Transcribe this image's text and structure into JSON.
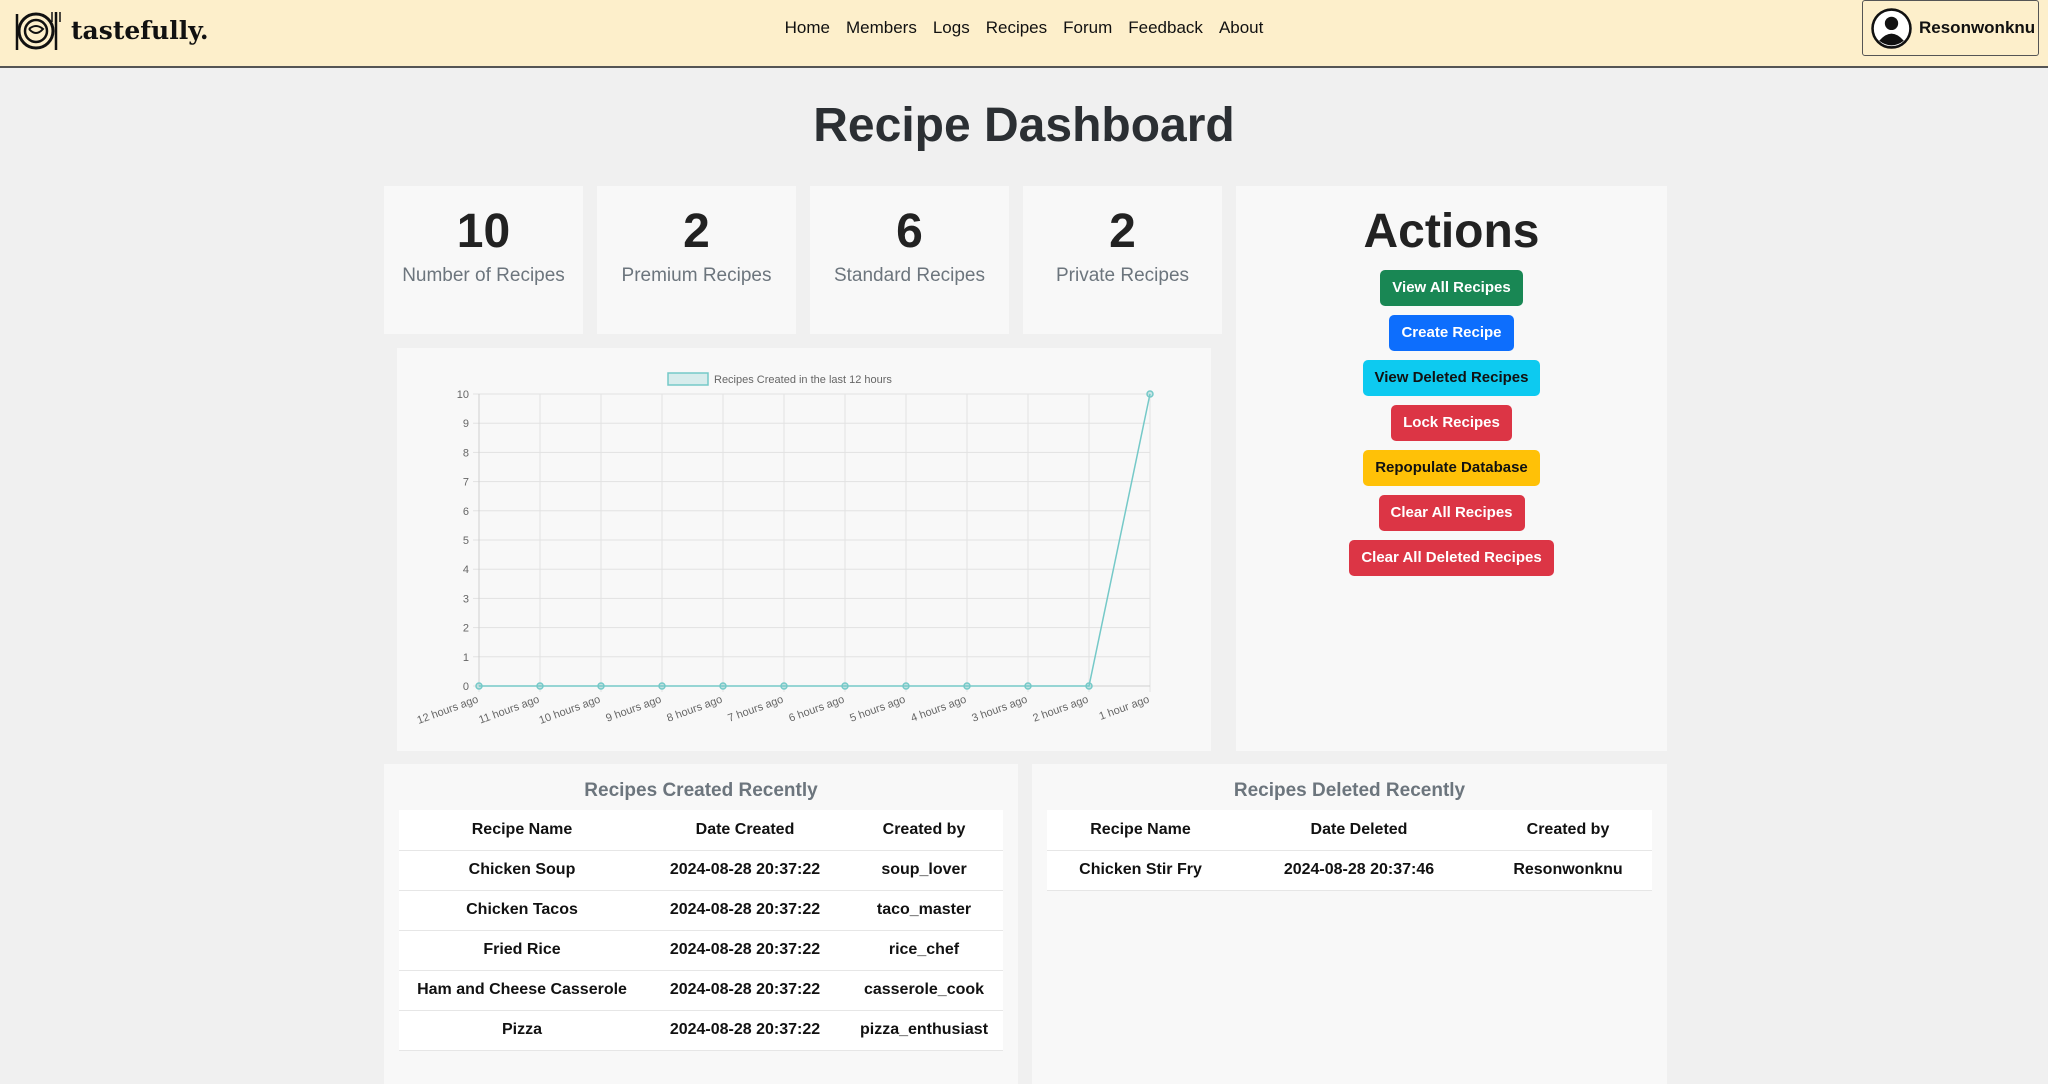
{
  "app": {
    "brand": "tastefully.",
    "nav": [
      "Home",
      "Members",
      "Logs",
      "Recipes",
      "Forum",
      "Feedback",
      "About"
    ],
    "user": "Resonwonknu"
  },
  "page": {
    "title": "Recipe Dashboard"
  },
  "stats": [
    {
      "value": "10",
      "label": "Number of Recipes"
    },
    {
      "value": "2",
      "label": "Premium Recipes"
    },
    {
      "value": "6",
      "label": "Standard Recipes"
    },
    {
      "value": "2",
      "label": "Private Recipes"
    }
  ],
  "actions": {
    "title": "Actions",
    "buttons": [
      {
        "label": "View All Recipes",
        "color": "#198754"
      },
      {
        "label": "Create Recipe",
        "color": "#0d6efd"
      },
      {
        "label": "View Deleted Recipes",
        "color": "#0dcaf0"
      },
      {
        "label": "Lock Recipes",
        "color": "#dc3545"
      },
      {
        "label": "Repopulate Database",
        "color": "#ffc107"
      },
      {
        "label": "Clear All Recipes",
        "color": "#dc3545"
      },
      {
        "label": "Clear All Deleted Recipes",
        "color": "#dc3545"
      }
    ]
  },
  "chart_data": {
    "type": "line",
    "legend": "Recipes Created in the last 12 hours",
    "legend_position": "top",
    "categories": [
      "12 hours ago",
      "11 hours ago",
      "10 hours ago",
      "9 hours ago",
      "8 hours ago",
      "7 hours ago",
      "6 hours ago",
      "5 hours ago",
      "4 hours ago",
      "3 hours ago",
      "2 hours ago",
      "1 hour ago"
    ],
    "series": [
      {
        "name": "Recipes Created in the last 12 hours",
        "values": [
          0,
          0,
          0,
          0,
          0,
          0,
          0,
          0,
          0,
          0,
          0,
          10
        ],
        "color": "#75c9c8"
      }
    ],
    "ylim": [
      0,
      10
    ],
    "yticks": [
      "0",
      "1",
      "2",
      "3",
      "4",
      "5",
      "6",
      "7",
      "8",
      "9",
      "10"
    ],
    "grid": true
  },
  "created_table": {
    "title": "Recipes Created Recently",
    "headers": [
      "Recipe Name",
      "Date Created",
      "Created by"
    ],
    "rows": [
      [
        "Chicken Soup",
        "2024-08-28 20:37:22",
        "soup_lover"
      ],
      [
        "Chicken Tacos",
        "2024-08-28 20:37:22",
        "taco_master"
      ],
      [
        "Fried Rice",
        "2024-08-28 20:37:22",
        "rice_chef"
      ],
      [
        "Ham and Cheese Casserole",
        "2024-08-28 20:37:22",
        "casserole_cook"
      ],
      [
        "Pizza",
        "2024-08-28 20:37:22",
        "pizza_enthusiast"
      ]
    ]
  },
  "deleted_table": {
    "title": "Recipes Deleted Recently",
    "headers": [
      "Recipe Name",
      "Date Deleted",
      "Created by"
    ],
    "rows": [
      [
        "Chicken Stir Fry",
        "2024-08-28 20:37:46",
        "Resonwonknu"
      ]
    ]
  }
}
